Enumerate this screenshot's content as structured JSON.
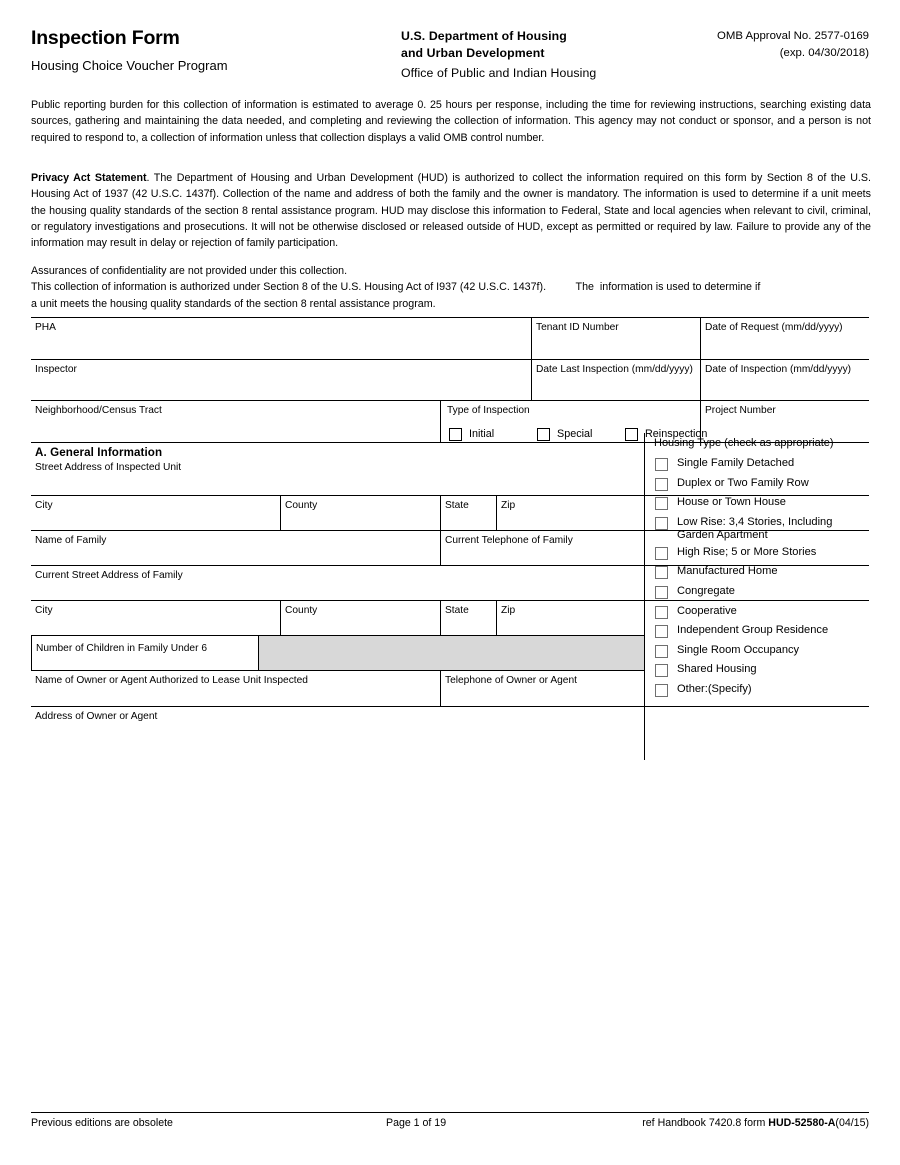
{
  "header": {
    "title": "Inspection Form",
    "subtitle": "Housing Choice Voucher Program",
    "agency_line1": "U.S. Department of Housing",
    "agency_line2": "and Urban Development",
    "office": "Office of Public and Indian Housing",
    "omb_approval": "OMB Approval No. 2577-0169",
    "omb_expiration": "(exp. 04/30/2018)"
  },
  "burden_statement": "Public reporting burden for this collection of information is estimated to average 0. 25 hours per response, including the time for reviewing instructions, searching existing data sources, gathering and maintaining the data needed, and completing and reviewing the collection of information. This agency may not conduct or sponsor, and a person is not required to respond to, a collection of information unless that collection displays a valid OMB control number.",
  "privacy": {
    "heading": "Privacy Act Statement",
    "body": ". The Department of Housing and Urban Development (HUD) is authorized to collect the information required on this form by Section 8 of the U.S. Housing Act of 1937 (42 U.S.C. 1437f). Collection of the name and address of both the family and the owner is mandatory. The information is used to determine if a unit meets the housing quality standards of the section 8 rental assistance program. HUD may disclose this information to Federal, State and local agencies when relevant to civil, criminal, or regulatory investigations and prosecutions. It will not be otherwise disclosed or released outside of HUD, except as permitted or required by law. Failure to provide any of the information may result in delay or rejection of family participation."
  },
  "assurances": {
    "line1": "Assurances of confidentiality are not provided under this collection.",
    "line2": "This collection of information is authorized under Section 8 of the U.S. Housing Act of I937 (42 U.S.C. 1437f).          The  information is used to determine if",
    "line3": "a unit meets the housing quality standards of the section 8 rental assistance program."
  },
  "form": {
    "pha": "PHA",
    "tenant_id": "Tenant ID Number",
    "date_of_request": "Date of Request (mm/dd/yyyy)",
    "inspector": "Inspector",
    "date_last_inspection": "Date Last Inspection (mm/dd/yyyy)",
    "date_of_inspection": "Date of Inspection (mm/dd/yyyy)",
    "neighborhood": "Neighborhood/Census Tract",
    "type_of_inspection": "Type of Inspection",
    "project_number": "Project Number",
    "inspection_types": [
      {
        "label": "Initial",
        "checked": false
      },
      {
        "label": "Special",
        "checked": false
      },
      {
        "label": "Reinspection",
        "checked": false
      }
    ],
    "section_a_heading": "A. General Information",
    "street_address_unit": "Street Address of Inspected Unit",
    "city": "City",
    "county": "County",
    "state": "State",
    "zip": "Zip",
    "name_of_family": "Name of Family",
    "current_telephone_family": "Current Telephone of Family",
    "current_street_address_family": "Current Street Address of Family",
    "city2": "City",
    "county2": "County",
    "state2": "State",
    "zip2": "Zip",
    "children_under_6": "Number of Children in Family Under 6",
    "name_of_owner": "Name of Owner or Agent Authorized to Lease Unit Inspected",
    "telephone_of_owner": "Telephone of Owner or Agent",
    "address_of_owner": "Address of Owner or Agent"
  },
  "housing_type": {
    "title": "Housing Type (check as appropriate)",
    "options": [
      {
        "label": "Single Family Detached",
        "checked": false
      },
      {
        "label": "Duplex or Two Family Row",
        "checked": false
      },
      {
        "label": "House or Town House",
        "checked": false
      },
      {
        "label": "Low Rise: 3,4 Stories, Including Garden Apartment",
        "checked": false
      },
      {
        "label": "High Rise; 5 or More Stories",
        "checked": false
      },
      {
        "label": "Manufactured Home",
        "checked": false
      },
      {
        "label": "Congregate",
        "checked": false
      },
      {
        "label": "Cooperative",
        "checked": false
      },
      {
        "label": "Independent Group Residence",
        "checked": false
      },
      {
        "label": "Single Room Occupancy",
        "checked": false
      },
      {
        "label": "Shared Housing",
        "checked": false
      },
      {
        "label": "Other:(Specify)",
        "checked": false
      }
    ]
  },
  "footer": {
    "left": "Previous editions are obsolete",
    "page": "Page 1 of 19",
    "ref_prefix": "ref Handbook 7420.8  form ",
    "form_number": "HUD-52580-A",
    "revision": "(04/15)"
  }
}
